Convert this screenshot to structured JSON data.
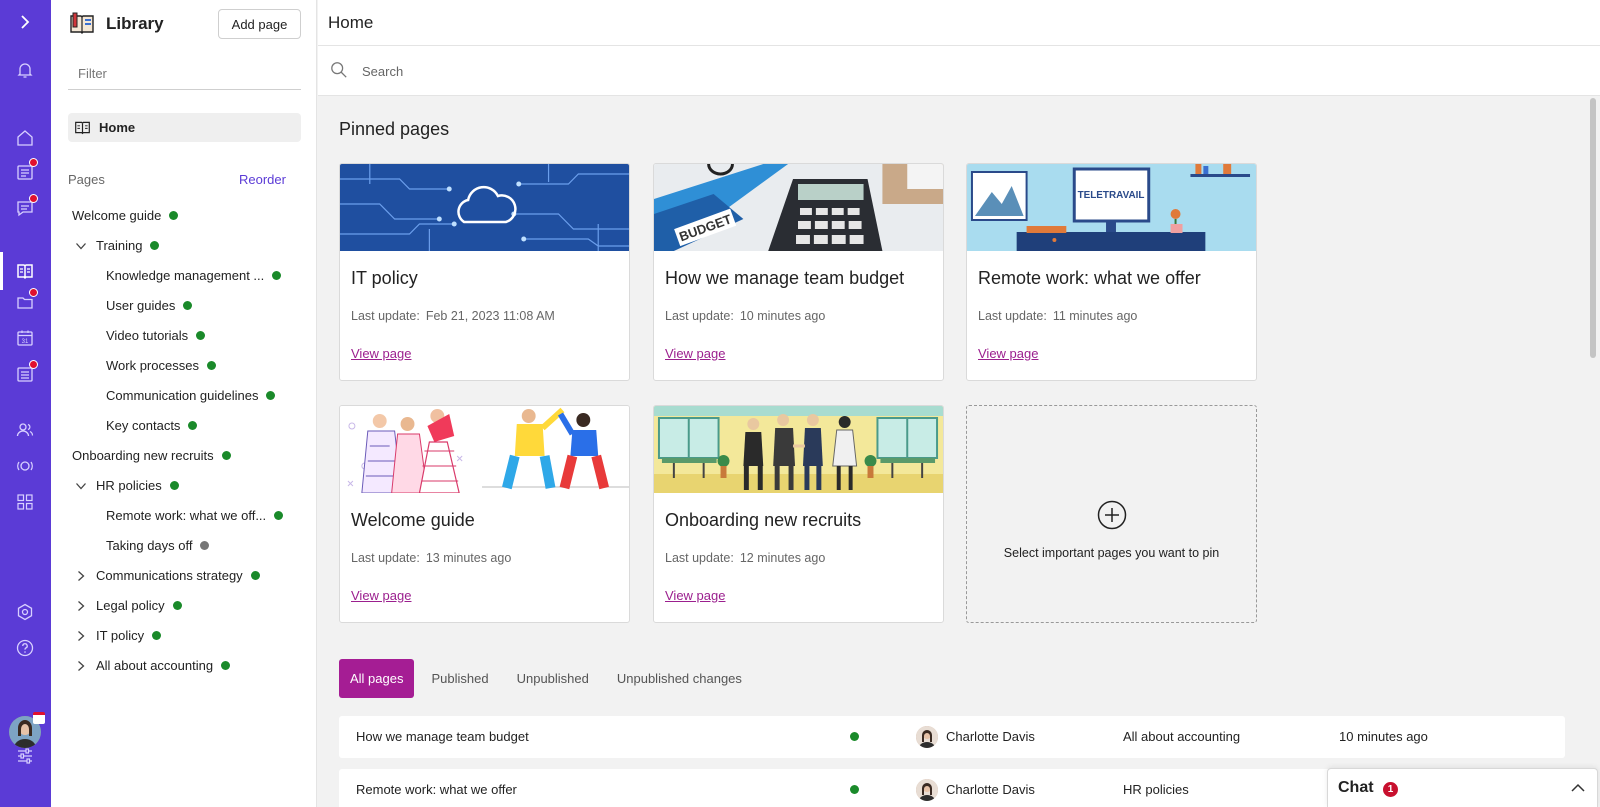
{
  "colors": {
    "rail": "#5b3bd6",
    "accent_tab": "#a51d94",
    "link": "#9b1f8e",
    "reorder": "#5b3bd6",
    "status_green": "#1a8a2a",
    "status_gray": "#777777",
    "notification": "#e0102f"
  },
  "rail": {
    "icons": [
      "expand-chevron-icon",
      "bell-icon",
      "home-icon",
      "news-icon",
      "chat-bubble-icon",
      "library-book-icon",
      "folder-icon",
      "calendar-icon",
      "tasks-icon",
      "people-icon",
      "community-icon",
      "apps-grid-icon",
      "settings-hexagon-icon",
      "help-icon",
      "sliders-icon"
    ],
    "calendar_number": "31"
  },
  "sidebar": {
    "title": "Library",
    "add_page_label": "Add page",
    "filter_placeholder": "Filter",
    "home_label": "Home",
    "pages_label": "Pages",
    "reorder_label": "Reorder",
    "tree": [
      {
        "label": "Welcome guide",
        "status": "published"
      },
      {
        "label": "Training",
        "status": "published",
        "expanded": true
      },
      {
        "label": "Knowledge management ...",
        "status": "published"
      },
      {
        "label": "User guides",
        "status": "published"
      },
      {
        "label": "Video tutorials",
        "status": "published"
      },
      {
        "label": "Work processes",
        "status": "published"
      },
      {
        "label": "Communication guidelines",
        "status": "published"
      },
      {
        "label": "Key contacts",
        "status": "published"
      },
      {
        "label": "Onboarding new recruits",
        "status": "published"
      },
      {
        "label": "HR policies",
        "status": "published",
        "expanded": true
      },
      {
        "label": "Remote work: what we off...",
        "status": "published"
      },
      {
        "label": "Taking days off",
        "status": "unpublished"
      },
      {
        "label": "Communications strategy",
        "status": "published",
        "expanded": false
      },
      {
        "label": "Legal policy",
        "status": "published",
        "expanded": false
      },
      {
        "label": "IT policy",
        "status": "published",
        "expanded": false
      },
      {
        "label": "All about accounting",
        "status": "published",
        "expanded": false
      }
    ]
  },
  "header": {
    "title": "Home",
    "search_placeholder": "Search"
  },
  "pinned": {
    "title": "Pinned pages",
    "cards": [
      {
        "title": "IT policy",
        "update_label": "Last update:",
        "update_value": "Feb 21, 2023 11:08 AM",
        "link": "View page"
      },
      {
        "title": "How we manage team budget",
        "update_label": "Last update:",
        "update_value": "10 minutes ago",
        "link": "View page",
        "image_text": "BUDGET"
      },
      {
        "title": "Remote work: what we offer",
        "update_label": "Last update:",
        "update_value": "11 minutes ago",
        "link": "View page",
        "image_text": "TELETRAVAIL"
      },
      {
        "title": "Welcome guide",
        "update_label": "Last update:",
        "update_value": "13 minutes ago",
        "link": "View page"
      },
      {
        "title": "Onboarding new recruits",
        "update_label": "Last update:",
        "update_value": "12 minutes ago",
        "link": "View page"
      }
    ],
    "add_hint": "Select important pages you want to pin"
  },
  "tabs": [
    "All pages",
    "Published",
    "Unpublished",
    "Unpublished changes"
  ],
  "active_tab": "All pages",
  "rows": [
    {
      "title": "How we manage team budget",
      "author": "Charlotte Davis",
      "parent": "All about accounting",
      "updated": "10 minutes ago"
    },
    {
      "title": "Remote work: what we offer",
      "author": "Charlotte Davis",
      "parent": "HR policies",
      "updated": ""
    }
  ],
  "chat": {
    "label": "Chat",
    "badge": "1"
  }
}
